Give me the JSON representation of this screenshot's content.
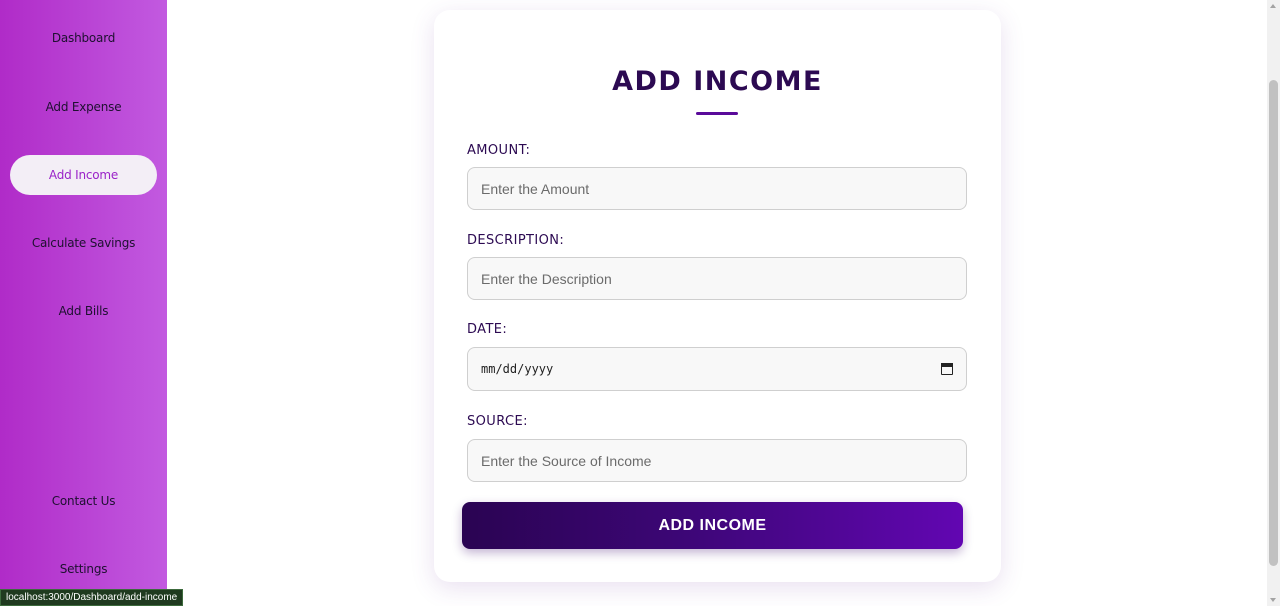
{
  "sidebar": {
    "items": [
      {
        "label": "Dashboard",
        "active": false
      },
      {
        "label": "Add Expense",
        "active": false
      },
      {
        "label": "Add Income",
        "active": true
      },
      {
        "label": "Calculate Savings",
        "active": false
      },
      {
        "label": "Add Bills",
        "active": false
      },
      {
        "label": "Contact Us",
        "active": false
      },
      {
        "label": "Settings",
        "active": false
      }
    ]
  },
  "form": {
    "title": "ADD INCOME",
    "amount": {
      "label": "AMOUNT:",
      "placeholder": "Enter the Amount",
      "value": ""
    },
    "description": {
      "label": "DESCRIPTION:",
      "placeholder": "Enter the Description",
      "value": ""
    },
    "date": {
      "label": "DATE:",
      "placeholder": "mm/dd/yyyy",
      "value": ""
    },
    "source": {
      "label": "SOURCE:",
      "placeholder": "Enter the Source of Income",
      "value": ""
    },
    "submit_label": "ADD INCOME"
  },
  "status_bar": {
    "url": "localhost:3000/Dashboard/add-income"
  },
  "icons": {
    "date_picker": "calendar-icon"
  },
  "colors": {
    "sidebar_gradient_start": "#b02bc8",
    "sidebar_gradient_end": "#c25ae0",
    "accent_dark": "#2c0a52",
    "button_gradient_end": "#6206b2",
    "active_nav_text": "#9a22c8"
  }
}
